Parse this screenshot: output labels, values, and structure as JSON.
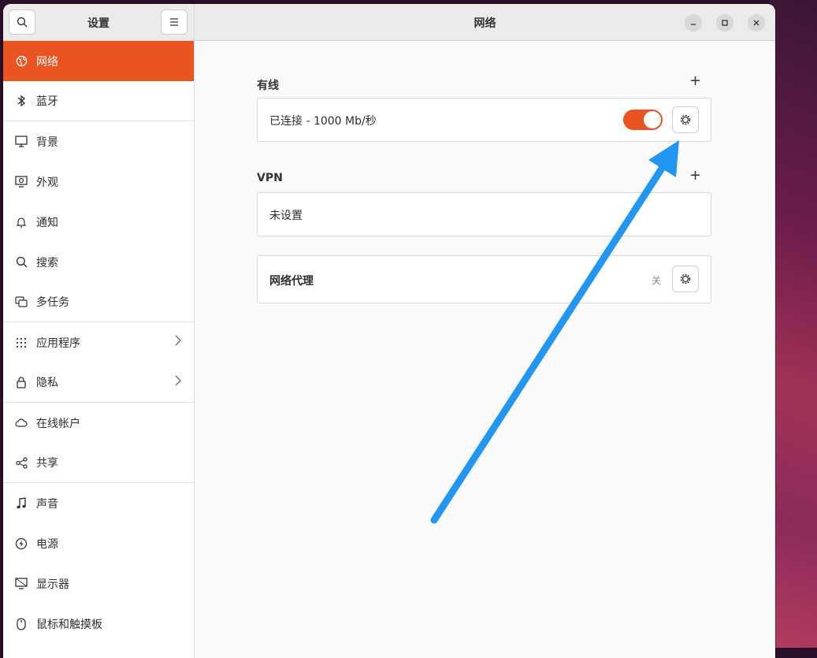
{
  "sidebar": {
    "title": "设置",
    "search_icon": "search-icon",
    "menu_icon": "hamburger-menu-icon",
    "items": [
      {
        "label": "网络",
        "icon": "globe-icon",
        "active": true
      },
      {
        "label": "蓝牙",
        "icon": "bluetooth-icon"
      },
      {
        "label": "背景",
        "icon": "monitor-icon"
      },
      {
        "label": "外观",
        "icon": "appearance-icon"
      },
      {
        "label": "通知",
        "icon": "bell-icon"
      },
      {
        "label": "搜索",
        "icon": "search-icon"
      },
      {
        "label": "多任务",
        "icon": "multitask-icon"
      },
      {
        "label": "应用程序",
        "icon": "grid-icon",
        "chevron": true
      },
      {
        "label": "隐私",
        "icon": "lock-icon",
        "chevron": true
      },
      {
        "label": "在线帐户",
        "icon": "cloud-icon"
      },
      {
        "label": "共享",
        "icon": "share-icon"
      },
      {
        "label": "声音",
        "icon": "music-note-icon"
      },
      {
        "label": "电源",
        "icon": "power-icon"
      },
      {
        "label": "显示器",
        "icon": "display-icon"
      },
      {
        "label": "鼠标和触摸板",
        "icon": "mouse-icon"
      }
    ]
  },
  "header": {
    "title": "网络",
    "minimize": "–",
    "maximize": "□",
    "close": "×"
  },
  "wired": {
    "section_title": "有线",
    "add_label": "+",
    "connection_label": "已连接 - 1000 Mb/秒",
    "toggle_on": true
  },
  "vpn": {
    "section_title": "VPN",
    "add_label": "+",
    "status": "未设置"
  },
  "proxy": {
    "label": "网络代理",
    "status": "关"
  },
  "colors": {
    "accent": "#e95420",
    "annotation_arrow": "#2196f3"
  }
}
